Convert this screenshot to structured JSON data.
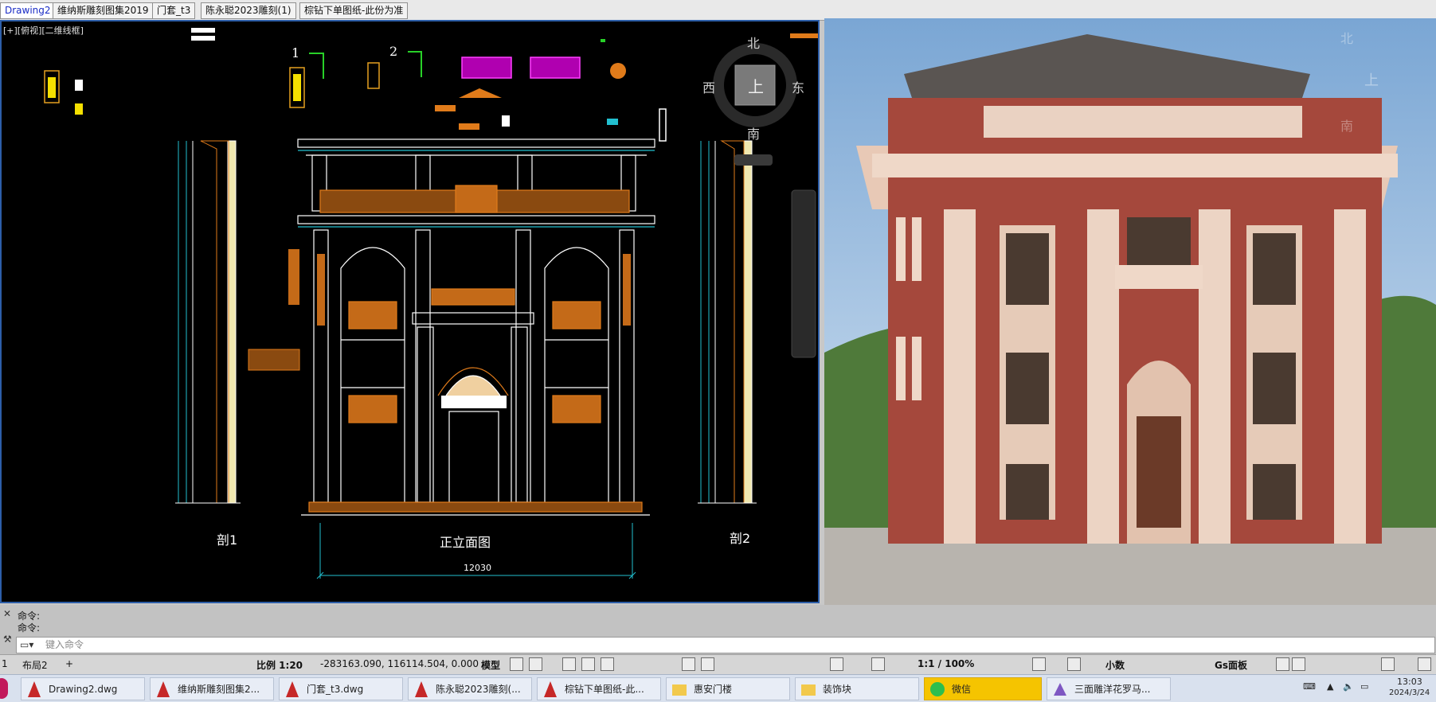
{
  "tabs": [
    "Drawing2",
    "维纳斯雕刻图集2019",
    "门套_t3",
    "陈永聪2023雕刻(1)",
    "棕钻下单图纸-此份为准"
  ],
  "viewport": {
    "label": "[+][俯视][二维线框]",
    "compass": {
      "north": "北",
      "south": "南",
      "east": "东",
      "west": "西",
      "top": "上"
    },
    "drawing": {
      "section_left": "剖1",
      "section_right": "剖2",
      "elevation_title": "正立面图",
      "dimension": "12030",
      "marker_1": "1",
      "marker_2": "2"
    }
  },
  "render": {
    "compass": {
      "north": "北",
      "south": "南",
      "top": "上"
    }
  },
  "command": {
    "history": [
      "命令:",
      "命令:"
    ],
    "placeholder": "键入命令"
  },
  "layout_tabs": {
    "current": "1",
    "layout2": "布局2",
    "add": "+"
  },
  "status": {
    "scale": "比例 1:20",
    "coords": "-283163.090, 116114.504, 0.000",
    "model": "模型",
    "annotation_scale": "1:1 / 100%",
    "units": "小数",
    "workspace": "Gs面板"
  },
  "taskbar": {
    "items": [
      "Drawing2.dwg",
      "维纳斯雕刻图集2...",
      "门套_t3.dwg",
      "陈永聪2023雕刻(...",
      "棕钻下单图纸-此...",
      "惠安门楼",
      "装饰块",
      "微信",
      "三面雕洋花罗马..."
    ],
    "time": "13:03",
    "date": "2024/3/24"
  },
  "colors": {
    "cad_background": "#000000",
    "accent": "#2d5ea8",
    "ornament": "#e07b1a"
  }
}
